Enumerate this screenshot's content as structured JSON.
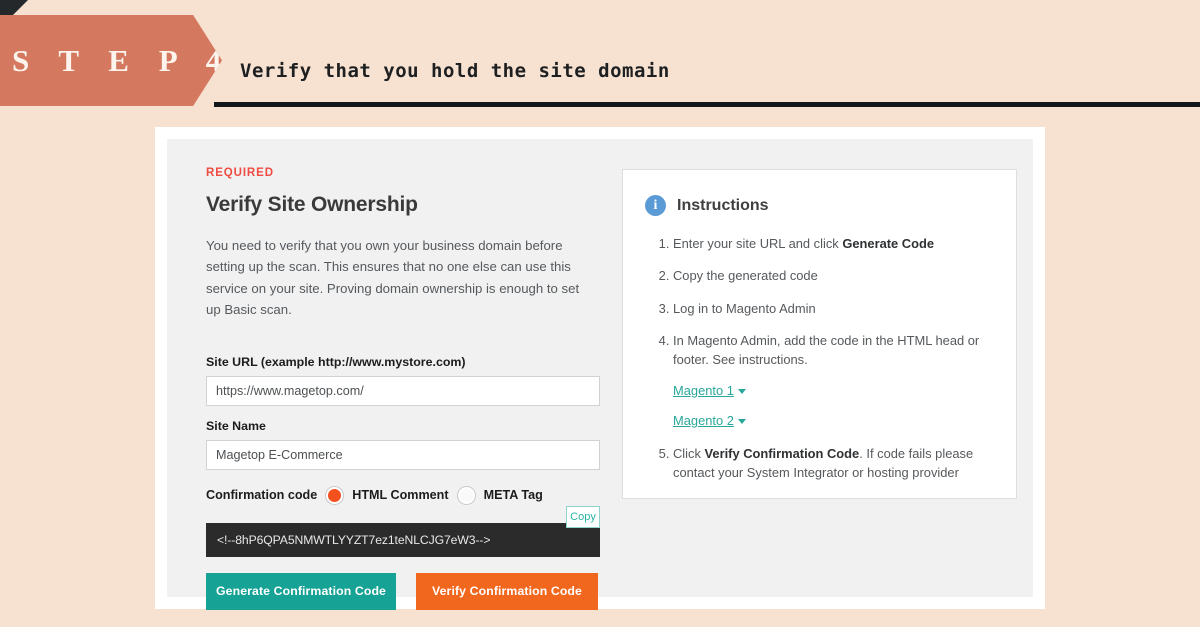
{
  "header": {
    "step_label": "S T E P  4",
    "title": "Verify that you hold the site domain"
  },
  "panel": {
    "required_tag": "REQUIRED",
    "heading": "Verify Site Ownership",
    "description": "You need to verify that you own your business domain before setting up the scan. This ensures that no one else can use this service on your site. Proving domain ownership is enough to set up Basic scan."
  },
  "form": {
    "site_url_label": "Site URL (example http://www.mystore.com)",
    "site_url_value": "https://www.magetop.com/",
    "site_url_placeholder": "http://www.mystore.com",
    "site_name_label": "Site Name",
    "site_name_value": "Magetop E-Commerce",
    "site_name_placeholder": "Site Name",
    "confirmation_label": "Confirmation code",
    "option_html_comment": "HTML Comment",
    "option_meta_tag": "META Tag",
    "copy_label": "Copy",
    "code_value": "<!--8hP6QPA5NMWTLYYZT7ez1teNLCJG7eW3-->",
    "generate_button": "Generate Confirmation Code",
    "verify_button": "Verify Confirmation Code"
  },
  "instructions": {
    "title": "Instructions",
    "icon": "info-icon",
    "items": [
      {
        "text_before": "Enter your site URL and click ",
        "bold": "Generate Code",
        "text_after": ""
      },
      {
        "text_before": "Copy the generated code",
        "bold": "",
        "text_after": ""
      },
      {
        "text_before": "Log in to Magento Admin",
        "bold": "",
        "text_after": ""
      },
      {
        "text_before": "In Magento Admin, add the code in the HTML head or footer. See instructions.",
        "bold": "",
        "text_after": ""
      },
      {
        "text_before": "Click ",
        "bold": "Verify Confirmation Code",
        "text_after": ". If code fails please contact your System Integrator or hosting provider"
      }
    ],
    "links": [
      {
        "label": "Magento 1"
      },
      {
        "label": "Magento 2"
      }
    ]
  },
  "colors": {
    "page_background": "#f7e2d2",
    "banner": "#d4795f",
    "required_red": "#ef4b43",
    "teal": "#16a396",
    "orange": "#f2671e",
    "radio_selected": "#f4511e",
    "link_teal": "#2aa79b",
    "info_blue": "#5b9bd5",
    "code_background": "#2b2b2b"
  }
}
